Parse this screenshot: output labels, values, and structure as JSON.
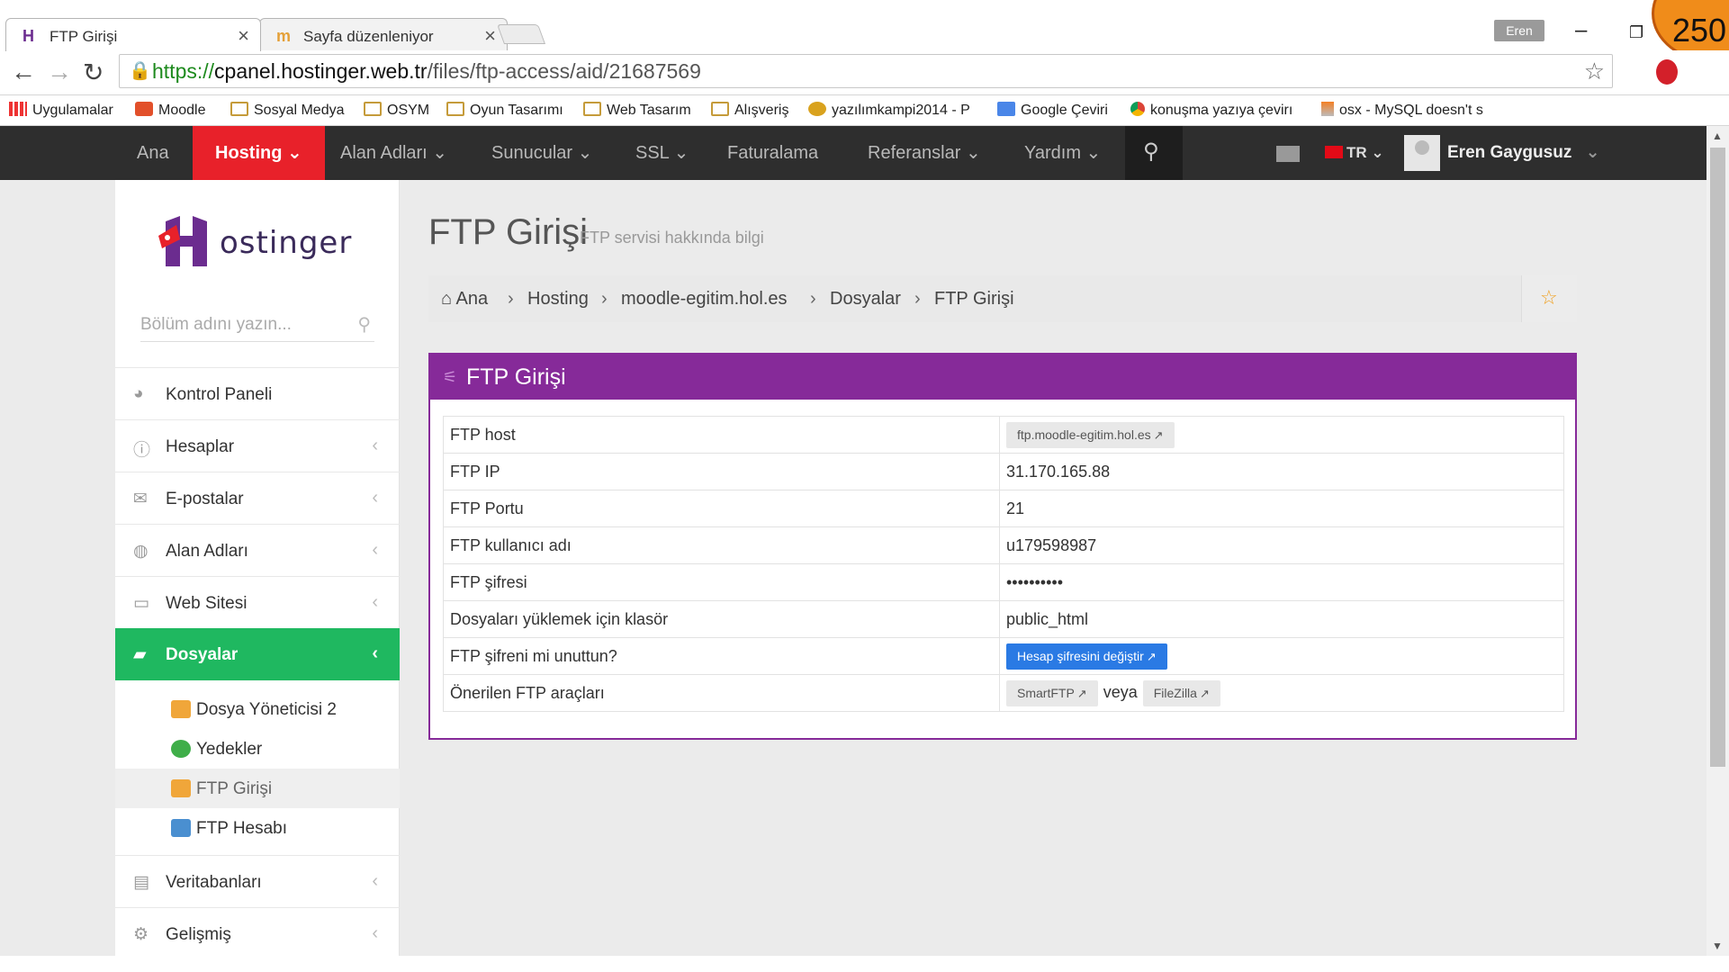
{
  "browser": {
    "tabs": [
      {
        "title": "FTP Girişi",
        "active": true
      },
      {
        "title": "Sayfa düzenleniyor",
        "active": false
      }
    ],
    "profile_name": "Eren",
    "badge_count": "250",
    "url_scheme": "https://",
    "url_host": "cpanel.hostinger.web.tr",
    "url_path": "/files/ftp-access/aid/21687569",
    "bookmarks": [
      {
        "label": "Uygulamalar",
        "icon": "apps-grid-icon"
      },
      {
        "label": "Moodle",
        "icon": "moodle-icon"
      },
      {
        "label": "Sosyal Medya",
        "icon": "folder-icon"
      },
      {
        "label": "OSYM",
        "icon": "folder-icon"
      },
      {
        "label": "Oyun Tasarımı",
        "icon": "folder-icon"
      },
      {
        "label": "Web Tasarım",
        "icon": "folder-icon"
      },
      {
        "label": "Alışveriş",
        "icon": "folder-icon"
      },
      {
        "label": "yazılımkampi2014 - P",
        "icon": "tiger-icon"
      },
      {
        "label": "Google Çeviri",
        "icon": "translate-icon"
      },
      {
        "label": "konuşma yazıya çevirı",
        "icon": "chrome-icon"
      },
      {
        "label": "osx - MySQL doesn't s",
        "icon": "stackoverflow-icon"
      }
    ]
  },
  "nav": {
    "items": [
      "Ana",
      "Hosting",
      "Alan Adları",
      "Sunucular",
      "SSL",
      "Faturalama",
      "Referanslar",
      "Yardım"
    ],
    "active": "Hosting",
    "language": "TR",
    "user": "Eren Gaygusuz"
  },
  "sidebar": {
    "logo_text": "ostinger",
    "search_placeholder": "Bölüm adını yazın...",
    "menu": [
      {
        "label": "Kontrol Paneli",
        "icon": "dashboard-icon"
      },
      {
        "label": "Hesaplar",
        "icon": "info-icon"
      },
      {
        "label": "E-postalar",
        "icon": "envelope-icon"
      },
      {
        "label": "Alan Adları",
        "icon": "globe-icon"
      },
      {
        "label": "Web Sitesi",
        "icon": "monitor-icon"
      },
      {
        "label": "Dosyalar",
        "icon": "folder-open-icon",
        "active": true
      },
      {
        "label": "Veritabanları",
        "icon": "database-icon"
      },
      {
        "label": "Gelişmiş",
        "icon": "cogs-icon"
      }
    ],
    "submenu": [
      {
        "label": "Dosya Yöneticisi 2",
        "color": "#f0a63a"
      },
      {
        "label": "Yedekler",
        "color": "#3fae49"
      },
      {
        "label": "FTP Girişi",
        "color": "#f0a63a",
        "current": true
      },
      {
        "label": "FTP Hesabı",
        "color": "#4a8fd0"
      }
    ]
  },
  "page": {
    "title": "FTP Girişi",
    "subtitle": "FTP servisi hakkında bilgi",
    "breadcrumb": [
      "Ana",
      "Hosting",
      "moodle-egitim.hol.es",
      "Dosyalar",
      "FTP Girişi"
    ]
  },
  "panel": {
    "title": "FTP Girişi",
    "rows": [
      {
        "key": "FTP host",
        "value": "ftp.moodle-egitim.hol.es"
      },
      {
        "key": "FTP IP",
        "value": "31.170.165.88"
      },
      {
        "key": "FTP Portu",
        "value": "21"
      },
      {
        "key": "FTP kullanıcı adı",
        "value": "u179598987"
      },
      {
        "key": "FTP şifresi",
        "value": "••••••••••"
      },
      {
        "key": "Dosyaları yüklemek için klasör",
        "value": "public_html"
      },
      {
        "key": "FTP şifreni mi unuttun?",
        "value": "Hesap şifresini değiştir"
      },
      {
        "key": "Önerilen FTP araçları",
        "value": ""
      }
    ],
    "tools": [
      "SmartFTP",
      "FileZilla"
    ],
    "or_text": "veya"
  },
  "colors": {
    "nav_active": "#e8212a",
    "panel_purple": "#862a99",
    "sidebar_active": "#1fb860",
    "button_blue": "#2a7ae4"
  }
}
